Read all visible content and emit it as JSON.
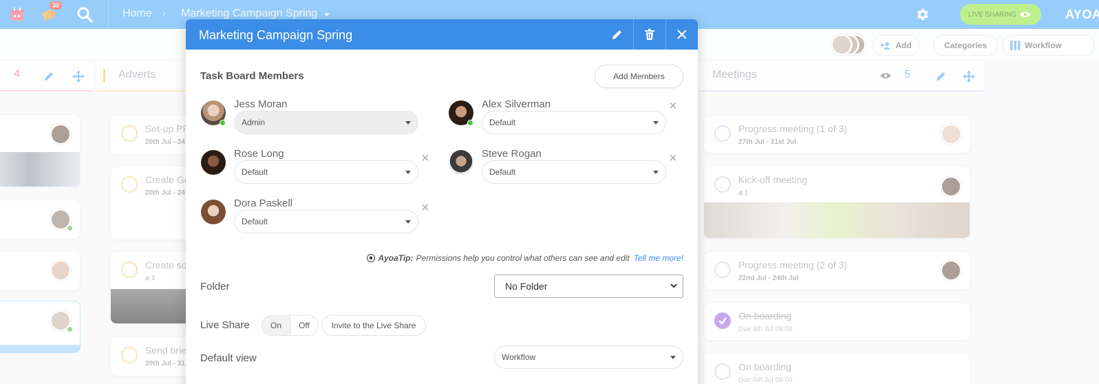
{
  "topbar": {
    "notification_count": "30",
    "breadcrumb_home": "Home",
    "breadcrumb_board": "Marketing Campaign Spring",
    "live_sharing_label": "LIVE SHARING",
    "logo": "AYOA",
    "accent_color": "#4da9f8"
  },
  "toolbar": {
    "add_label": "Add",
    "categories_label": "Categories",
    "workflow_label": "Workflow"
  },
  "columns": {
    "left": {
      "count": "4"
    },
    "adverts": {
      "title": "Adverts"
    },
    "meetings": {
      "title": "Meetings",
      "count": "5"
    }
  },
  "adverts_cards": [
    {
      "title": "Set-up PP",
      "date": "20th Jul - 24"
    },
    {
      "title": "Create Go",
      "date": "20th Jul - 24"
    },
    {
      "title": "Create so",
      "date": "1"
    },
    {
      "title": "Send brie",
      "date": "20th Jul - 31"
    }
  ],
  "meetings_cards": [
    {
      "title": "Progress meeting (1 of 3)",
      "date": "27th Jul - 31st Jul"
    },
    {
      "title": "Kick-off meeting",
      "date": "1"
    },
    {
      "title": "Progress meeting (2 of 3)",
      "date": "22nd Jul - 24th Jul"
    },
    {
      "title": "On boarding",
      "date": "Due 6th Jul 09:00"
    },
    {
      "title": "On boarding",
      "date": "Due 6th Jul 09:00"
    }
  ],
  "modal": {
    "title": "Marketing Campaign Spring",
    "members_title": "Task Board Members",
    "add_members_label": "Add Members",
    "members": [
      {
        "name": "Jess Moran",
        "role": "Admin",
        "online": true
      },
      {
        "name": "Alex Silverman",
        "role": "Default",
        "online": true
      },
      {
        "name": "Rose Long",
        "role": "Default",
        "online": false
      },
      {
        "name": "Steve Rogan",
        "role": "Default",
        "online": false
      },
      {
        "name": "Dora Paskell",
        "role": "Default",
        "online": false
      }
    ],
    "tip_label": "AyoaTip:",
    "tip_text": "Permissions help you control what others can see and edit",
    "tip_link": "Tell me more!",
    "folder_label": "Folder",
    "folder_value": "No Folder",
    "live_share_label": "Live Share",
    "live_share_on": "On",
    "live_share_off": "Off",
    "invite_label": "Invite to the Live Share",
    "default_view_label": "Default view",
    "default_view_value": "Workflow",
    "header_color": "#3b8de6"
  }
}
